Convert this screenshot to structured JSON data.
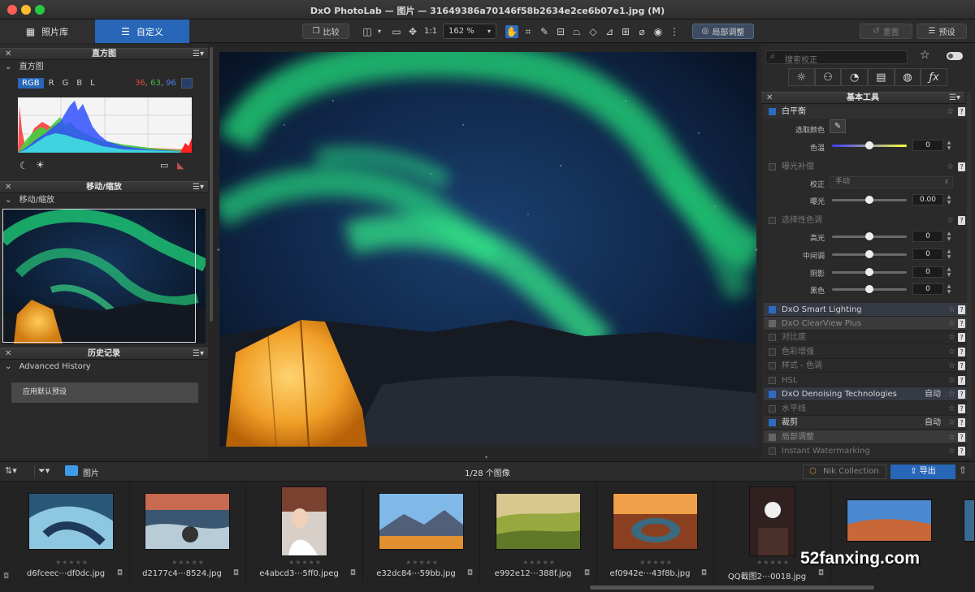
{
  "window": {
    "title": "DxO PhotoLab — 图片 — 31649386a70146f58b2634e2ce6b07e1.jpg (M)"
  },
  "toolbar": {
    "tab_library": "照片库",
    "tab_customize": "自定义",
    "compare_label": "比较",
    "ratio_label": "1:1",
    "zoom_value": "162 %",
    "local_adjust_label": "局部调整",
    "reset_label": "重置",
    "preset_label": "预设"
  },
  "histogram": {
    "panel_title": "直方图",
    "sub_title": "直方图",
    "channels": [
      "RGB",
      "R",
      "G",
      "B",
      "L"
    ],
    "value_r": "36",
    "value_g": "63",
    "value_b": "96"
  },
  "navigator": {
    "panel_title": "移动/缩放",
    "sub_title": "移动/缩放"
  },
  "history": {
    "panel_title": "历史记录",
    "sub_title": "Advanced History",
    "items": [
      "应用默认预设"
    ]
  },
  "right_panel": {
    "search_placeholder": "搜索校正",
    "basic_tools_title": "基本工具",
    "white_balance": {
      "title": "白平衡",
      "pick_color_label": "选取颜色",
      "temp_label": "色温",
      "temp_value": "0"
    },
    "exposure": {
      "title": "曝光补偿",
      "correction_label": "校正",
      "correction_value": "手动",
      "exposure_label": "曝光",
      "exposure_value": "0.00"
    },
    "selective_tone": {
      "title": "选择性色调",
      "highlights_label": "高光",
      "midtones_label": "中间调",
      "shadows_label": "阴影",
      "blacks_label": "黑色",
      "highlights_value": "0",
      "midtones_value": "0",
      "shadows_value": "0",
      "blacks_value": "0"
    },
    "tools": [
      {
        "label": "DxO Smart Lighting",
        "status": ""
      },
      {
        "label": "DxO ClearView Plus",
        "status": ""
      },
      {
        "label": "对比度",
        "status": ""
      },
      {
        "label": "色彩增强",
        "status": ""
      },
      {
        "label": "样式 - 色调",
        "status": ""
      },
      {
        "label": "HSL",
        "status": ""
      },
      {
        "label": "DxO Denoising Technologies",
        "status": "自动"
      },
      {
        "label": "水平线",
        "status": ""
      },
      {
        "label": "裁剪",
        "status": "自动"
      },
      {
        "label": "局部调整",
        "status": ""
      },
      {
        "label": "Instant Watermarking",
        "status": ""
      }
    ]
  },
  "filmstrip": {
    "folder": "图片",
    "count": "1/28 个图像",
    "nik_label": "Nik Collection",
    "export_label": "导出",
    "stars": "★★★★★",
    "files": [
      "d6fceec⋯df0dc.jpg",
      "d2177c4⋯8524.jpg",
      "e4abcd3⋯5ff0.jpeg",
      "e32dc84⋯59bb.jpg",
      "e992e12⋯388f.jpg",
      "ef0942e⋯43f8b.jpg",
      "QQ截图2⋯0018.jpg"
    ]
  },
  "watermark": "52fanxing.com",
  "colors": {
    "accent": "#2d6ac2",
    "value_r": "#e0483c",
    "value_g": "#48b84a",
    "value_b": "#4f7fe0"
  }
}
